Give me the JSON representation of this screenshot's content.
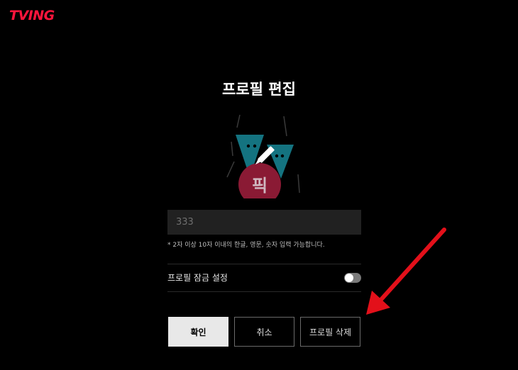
{
  "header": {
    "logo_text": "TVING"
  },
  "page": {
    "title": "프로필 편집"
  },
  "avatar": {
    "badge_text": "픽",
    "edit_icon": "pencil-icon"
  },
  "name_field": {
    "value": "",
    "placeholder": "333"
  },
  "hint": {
    "text": "* 2자 이상 10자 이내의 한글, 영문, 숫자 입력 가능합니다."
  },
  "lock": {
    "label": "프로필 잠금 설정",
    "enabled": false
  },
  "buttons": {
    "confirm": "확인",
    "cancel": "취소",
    "delete": "프로필 삭제"
  },
  "colors": {
    "brand": "#ff153c",
    "background": "#000000",
    "annotation_arrow": "#e3101a"
  }
}
